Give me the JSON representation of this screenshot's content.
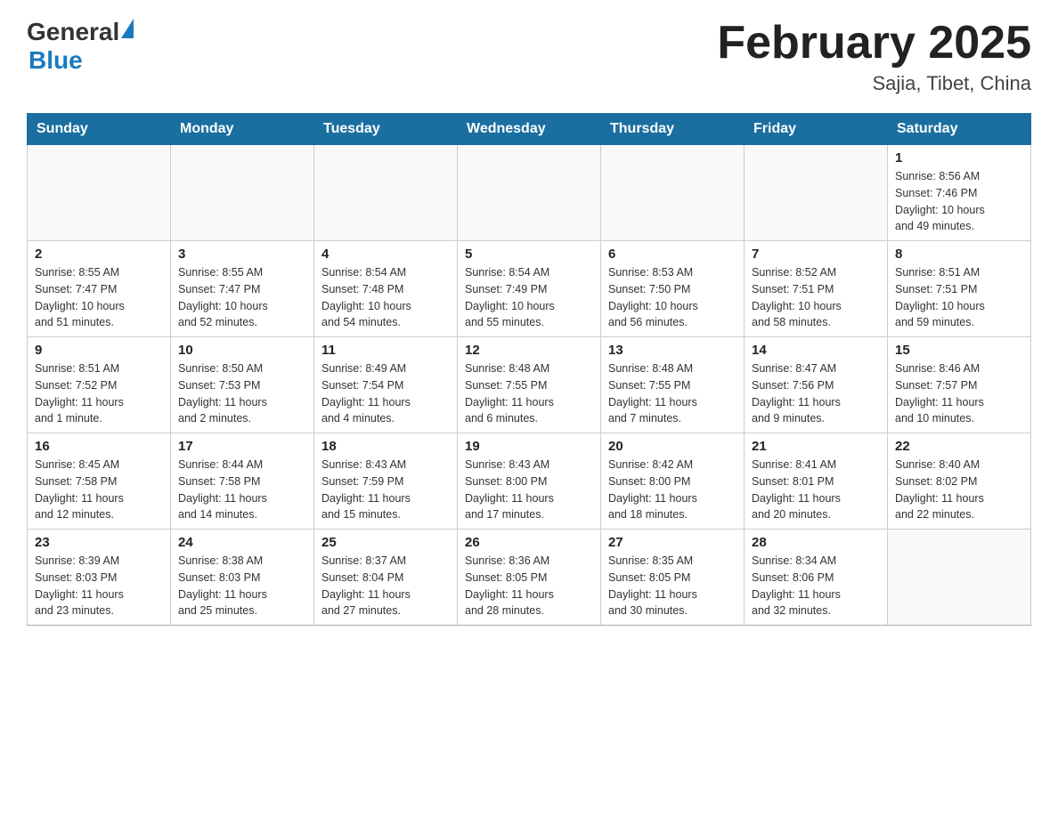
{
  "header": {
    "logo_general": "General",
    "logo_blue": "Blue",
    "title": "February 2025",
    "location": "Sajia, Tibet, China"
  },
  "weekdays": [
    "Sunday",
    "Monday",
    "Tuesday",
    "Wednesday",
    "Thursday",
    "Friday",
    "Saturday"
  ],
  "weeks": [
    [
      {
        "day": "",
        "info": ""
      },
      {
        "day": "",
        "info": ""
      },
      {
        "day": "",
        "info": ""
      },
      {
        "day": "",
        "info": ""
      },
      {
        "day": "",
        "info": ""
      },
      {
        "day": "",
        "info": ""
      },
      {
        "day": "1",
        "info": "Sunrise: 8:56 AM\nSunset: 7:46 PM\nDaylight: 10 hours\nand 49 minutes."
      }
    ],
    [
      {
        "day": "2",
        "info": "Sunrise: 8:55 AM\nSunset: 7:47 PM\nDaylight: 10 hours\nand 51 minutes."
      },
      {
        "day": "3",
        "info": "Sunrise: 8:55 AM\nSunset: 7:47 PM\nDaylight: 10 hours\nand 52 minutes."
      },
      {
        "day": "4",
        "info": "Sunrise: 8:54 AM\nSunset: 7:48 PM\nDaylight: 10 hours\nand 54 minutes."
      },
      {
        "day": "5",
        "info": "Sunrise: 8:54 AM\nSunset: 7:49 PM\nDaylight: 10 hours\nand 55 minutes."
      },
      {
        "day": "6",
        "info": "Sunrise: 8:53 AM\nSunset: 7:50 PM\nDaylight: 10 hours\nand 56 minutes."
      },
      {
        "day": "7",
        "info": "Sunrise: 8:52 AM\nSunset: 7:51 PM\nDaylight: 10 hours\nand 58 minutes."
      },
      {
        "day": "8",
        "info": "Sunrise: 8:51 AM\nSunset: 7:51 PM\nDaylight: 10 hours\nand 59 minutes."
      }
    ],
    [
      {
        "day": "9",
        "info": "Sunrise: 8:51 AM\nSunset: 7:52 PM\nDaylight: 11 hours\nand 1 minute."
      },
      {
        "day": "10",
        "info": "Sunrise: 8:50 AM\nSunset: 7:53 PM\nDaylight: 11 hours\nand 2 minutes."
      },
      {
        "day": "11",
        "info": "Sunrise: 8:49 AM\nSunset: 7:54 PM\nDaylight: 11 hours\nand 4 minutes."
      },
      {
        "day": "12",
        "info": "Sunrise: 8:48 AM\nSunset: 7:55 PM\nDaylight: 11 hours\nand 6 minutes."
      },
      {
        "day": "13",
        "info": "Sunrise: 8:48 AM\nSunset: 7:55 PM\nDaylight: 11 hours\nand 7 minutes."
      },
      {
        "day": "14",
        "info": "Sunrise: 8:47 AM\nSunset: 7:56 PM\nDaylight: 11 hours\nand 9 minutes."
      },
      {
        "day": "15",
        "info": "Sunrise: 8:46 AM\nSunset: 7:57 PM\nDaylight: 11 hours\nand 10 minutes."
      }
    ],
    [
      {
        "day": "16",
        "info": "Sunrise: 8:45 AM\nSunset: 7:58 PM\nDaylight: 11 hours\nand 12 minutes."
      },
      {
        "day": "17",
        "info": "Sunrise: 8:44 AM\nSunset: 7:58 PM\nDaylight: 11 hours\nand 14 minutes."
      },
      {
        "day": "18",
        "info": "Sunrise: 8:43 AM\nSunset: 7:59 PM\nDaylight: 11 hours\nand 15 minutes."
      },
      {
        "day": "19",
        "info": "Sunrise: 8:43 AM\nSunset: 8:00 PM\nDaylight: 11 hours\nand 17 minutes."
      },
      {
        "day": "20",
        "info": "Sunrise: 8:42 AM\nSunset: 8:00 PM\nDaylight: 11 hours\nand 18 minutes."
      },
      {
        "day": "21",
        "info": "Sunrise: 8:41 AM\nSunset: 8:01 PM\nDaylight: 11 hours\nand 20 minutes."
      },
      {
        "day": "22",
        "info": "Sunrise: 8:40 AM\nSunset: 8:02 PM\nDaylight: 11 hours\nand 22 minutes."
      }
    ],
    [
      {
        "day": "23",
        "info": "Sunrise: 8:39 AM\nSunset: 8:03 PM\nDaylight: 11 hours\nand 23 minutes."
      },
      {
        "day": "24",
        "info": "Sunrise: 8:38 AM\nSunset: 8:03 PM\nDaylight: 11 hours\nand 25 minutes."
      },
      {
        "day": "25",
        "info": "Sunrise: 8:37 AM\nSunset: 8:04 PM\nDaylight: 11 hours\nand 27 minutes."
      },
      {
        "day": "26",
        "info": "Sunrise: 8:36 AM\nSunset: 8:05 PM\nDaylight: 11 hours\nand 28 minutes."
      },
      {
        "day": "27",
        "info": "Sunrise: 8:35 AM\nSunset: 8:05 PM\nDaylight: 11 hours\nand 30 minutes."
      },
      {
        "day": "28",
        "info": "Sunrise: 8:34 AM\nSunset: 8:06 PM\nDaylight: 11 hours\nand 32 minutes."
      },
      {
        "day": "",
        "info": ""
      }
    ]
  ]
}
